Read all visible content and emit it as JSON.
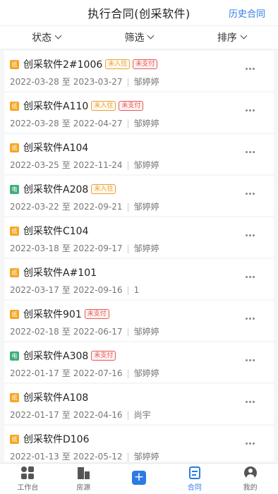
{
  "header": {
    "title": "执行合同(创采软件)",
    "history": "历史合同"
  },
  "filters": [
    {
      "label": "状态"
    },
    {
      "label": "筛选"
    },
    {
      "label": "排序"
    }
  ],
  "contracts": [
    {
      "type": "纸",
      "name": "创采软件2#1006",
      "tags": [
        "未入住",
        "未支付"
      ],
      "start": "2022-03-28",
      "end": "2023-03-27",
      "person": "邹婷婷"
    },
    {
      "type": "纸",
      "name": "创采软件A110",
      "tags": [
        "未入住",
        "未支付"
      ],
      "start": "2022-03-28",
      "end": "2022-04-27",
      "person": "邹婷婷"
    },
    {
      "type": "纸",
      "name": "创采软件A104",
      "tags": [],
      "start": "2022-03-25",
      "end": "2022-11-24",
      "person": "邹婷婷"
    },
    {
      "type": "电",
      "name": "创采软件A208",
      "tags": [
        "未入住"
      ],
      "start": "2022-03-22",
      "end": "2022-09-21",
      "person": "邹婷婷"
    },
    {
      "type": "纸",
      "name": "创采软件C104",
      "tags": [],
      "start": "2022-03-18",
      "end": "2022-09-17",
      "person": "邹婷婷"
    },
    {
      "type": "纸",
      "name": "创采软件A#101",
      "tags": [],
      "start": "2022-03-17",
      "end": "2022-09-16",
      "person": "1"
    },
    {
      "type": "纸",
      "name": "创采软件901",
      "tags": [
        "未支付"
      ],
      "start": "2022-02-18",
      "end": "2022-06-17",
      "person": "邹婷婷"
    },
    {
      "type": "电",
      "name": "创采软件A308",
      "tags": [
        "未支付"
      ],
      "start": "2022-01-17",
      "end": "2022-07-16",
      "person": "邹婷婷"
    },
    {
      "type": "纸",
      "name": "创采软件A108",
      "tags": [],
      "start": "2022-01-17",
      "end": "2022-04-16",
      "person": "尚宇"
    },
    {
      "type": "纸",
      "name": "创采软件D106",
      "tags": [],
      "start": "2022-01-13",
      "end": "2022-05-12",
      "person": "邹婷婷"
    }
  ],
  "date_connector": "至",
  "tabbar": [
    {
      "label": "工作台",
      "icon": "workbench-icon"
    },
    {
      "label": "房源",
      "icon": "building-icon"
    },
    {
      "label": "",
      "icon": "plus-icon"
    },
    {
      "label": "合同",
      "icon": "contract-icon",
      "active": true
    },
    {
      "label": "我的",
      "icon": "user-icon"
    }
  ],
  "colors": {
    "accent": "#2c7be5",
    "paper_badge": "#f5a623",
    "electronic_badge": "#3fae7c",
    "tag_unoccupied": "#e6a23c",
    "tag_unpaid": "#e55b56"
  }
}
